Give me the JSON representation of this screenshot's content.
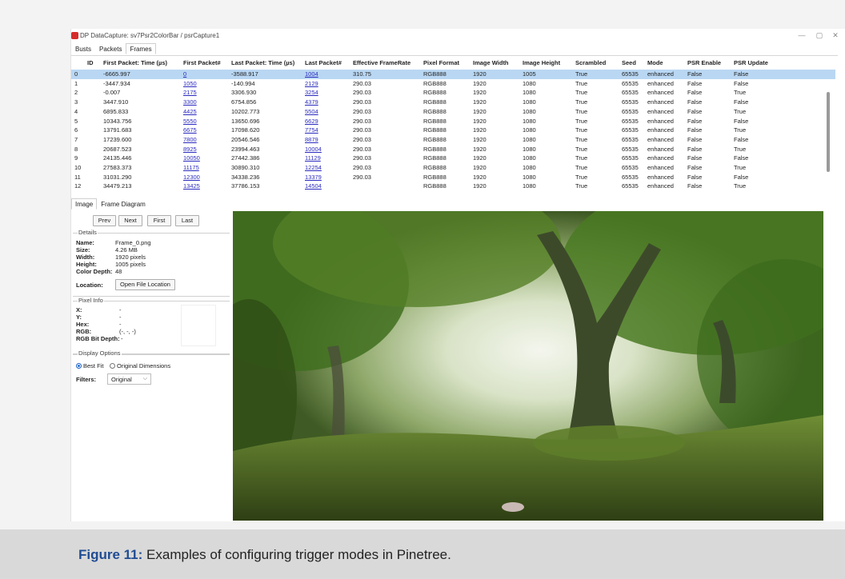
{
  "window": {
    "title": "DP DataCapture: sv7Psr2ColorBar / psrCapture1",
    "controls": [
      "—",
      "▢",
      "✕"
    ]
  },
  "top_tabs": [
    "Busts",
    "Packets",
    "Frames"
  ],
  "table": {
    "columns": [
      "ID",
      "First Packet: Time (µs)",
      "First Packet#",
      "Last Packet: Time (µs)",
      "Last Packet#",
      "Effective FrameRate",
      "Pixel Format",
      "Image Width",
      "Image Height",
      "Scrambled",
      "Seed",
      "Mode",
      "PSR Enable",
      "PSR Update"
    ],
    "rows": [
      [
        "0",
        "-6665.997",
        "0",
        "-3588.917",
        "1004",
        "310.75",
        "RGB888",
        "1920",
        "1005",
        "True",
        "65535",
        "enhanced",
        "False",
        "False"
      ],
      [
        "1",
        "-3447.934",
        "1050",
        "-140.994",
        "2129",
        "290.03",
        "RGB888",
        "1920",
        "1080",
        "True",
        "65535",
        "enhanced",
        "False",
        "False"
      ],
      [
        "2",
        "-0.007",
        "2175",
        "3306.930",
        "3254",
        "290.03",
        "RGB888",
        "1920",
        "1080",
        "True",
        "65535",
        "enhanced",
        "False",
        "True"
      ],
      [
        "3",
        "3447.910",
        "3300",
        "6754.856",
        "4379",
        "290.03",
        "RGB888",
        "1920",
        "1080",
        "True",
        "65535",
        "enhanced",
        "False",
        "False"
      ],
      [
        "4",
        "6895.833",
        "4425",
        "10202.773",
        "5504",
        "290.03",
        "RGB888",
        "1920",
        "1080",
        "True",
        "65535",
        "enhanced",
        "False",
        "True"
      ],
      [
        "5",
        "10343.756",
        "5550",
        "13650.696",
        "6629",
        "290.03",
        "RGB888",
        "1920",
        "1080",
        "True",
        "65535",
        "enhanced",
        "False",
        "False"
      ],
      [
        "6",
        "13791.683",
        "6675",
        "17098.620",
        "7754",
        "290.03",
        "RGB888",
        "1920",
        "1080",
        "True",
        "65535",
        "enhanced",
        "False",
        "True"
      ],
      [
        "7",
        "17239.600",
        "7800",
        "20546.546",
        "8879",
        "290.03",
        "RGB888",
        "1920",
        "1080",
        "True",
        "65535",
        "enhanced",
        "False",
        "False"
      ],
      [
        "8",
        "20687.523",
        "8925",
        "23994.463",
        "10004",
        "290.03",
        "RGB888",
        "1920",
        "1080",
        "True",
        "65535",
        "enhanced",
        "False",
        "True"
      ],
      [
        "9",
        "24135.446",
        "10050",
        "27442.386",
        "11129",
        "290.03",
        "RGB888",
        "1920",
        "1080",
        "True",
        "65535",
        "enhanced",
        "False",
        "False"
      ],
      [
        "10",
        "27583.373",
        "11175",
        "30890.310",
        "12254",
        "290.03",
        "RGB888",
        "1920",
        "1080",
        "True",
        "65535",
        "enhanced",
        "False",
        "True"
      ],
      [
        "11",
        "31031.290",
        "12300",
        "34338.236",
        "13379",
        "290.03",
        "RGB888",
        "1920",
        "1080",
        "True",
        "65535",
        "enhanced",
        "False",
        "False"
      ],
      [
        "12",
        "34479.213",
        "13425",
        "37786.153",
        "14504",
        "",
        "RGB888",
        "1920",
        "1080",
        "True",
        "65535",
        "enhanced",
        "False",
        "True"
      ]
    ]
  },
  "sub_tabs": [
    "Image",
    "Frame Diagram"
  ],
  "nav_buttons": [
    "Prev",
    "Next",
    "First",
    "Last"
  ],
  "details": {
    "group_label": "Details",
    "name_label": "Name:",
    "name": "Frame_0.png",
    "size_label": "Size:",
    "size": "4.26 MB",
    "width_label": "Width:",
    "width": "1920 pixels",
    "height_label": "Height:",
    "height": "1005 pixels",
    "depth_label": "Color Depth:",
    "depth": "48",
    "location_label": "Location:",
    "open_location": "Open File Location"
  },
  "pixel_info": {
    "group_label": "Pixel Info",
    "x_label": "X:",
    "x": "-",
    "y_label": "Y:",
    "y": "-",
    "hex_label": "Hex:",
    "hex": "-",
    "rgb_label": "RGB:",
    "rgb": "(-, -, -)",
    "bitdepth_label": "RGB Bit Depth:",
    "bitdepth": "-"
  },
  "display_options": {
    "group_label": "Display Options",
    "best_fit": "Best Fit",
    "original_dims": "Original Dimensions",
    "filters_label": "Filters:",
    "filter_value": "Original"
  },
  "caption": {
    "label": "Figure 11:",
    "text": " Examples of configuring trigger modes in Pinetree."
  },
  "colors": {
    "selection": "#b9d7f3",
    "link": "#2b2bbf",
    "caption_label": "#1f4c94"
  }
}
